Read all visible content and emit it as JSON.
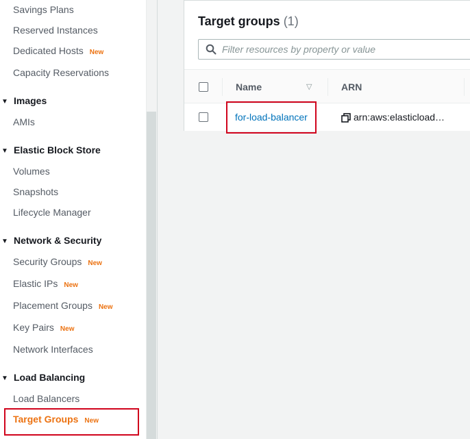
{
  "sidebar": {
    "new_badge": "New",
    "items": [
      {
        "label": "Savings Plans",
        "new": false
      },
      {
        "label": "Reserved Instances",
        "new": false
      },
      {
        "label": "Dedicated Hosts",
        "new": true
      },
      {
        "label": "Capacity Reservations",
        "new": false
      }
    ],
    "sections": {
      "images": {
        "heading": "Images",
        "items": [
          "AMIs"
        ]
      },
      "ebs": {
        "heading": "Elastic Block Store",
        "items": [
          "Volumes",
          "Snapshots",
          "Lifecycle Manager"
        ]
      },
      "network": {
        "heading": "Network & Security",
        "items": [
          {
            "label": "Security Groups",
            "new": true
          },
          {
            "label": "Elastic IPs",
            "new": true
          },
          {
            "label": "Placement Groups",
            "new": true
          },
          {
            "label": "Key Pairs",
            "new": true
          },
          {
            "label": "Network Interfaces",
            "new": false
          }
        ]
      },
      "lb": {
        "heading": "Load Balancing",
        "items": [
          {
            "label": "Load Balancers",
            "new": false
          },
          {
            "label": "Target Groups",
            "new": true,
            "active": true
          }
        ]
      }
    }
  },
  "main": {
    "title": "Target groups",
    "count": "(1)",
    "search": {
      "placeholder": "Filter resources by property or value"
    },
    "table": {
      "columns": [
        "Name",
        "ARN"
      ],
      "rows": [
        {
          "name": "for-load-balancer",
          "arn": "arn:aws:elasticload…"
        }
      ]
    }
  },
  "colors": {
    "accent_orange": "#ec7211",
    "link_blue": "#0073bb",
    "highlight_red": "#d0021b"
  }
}
